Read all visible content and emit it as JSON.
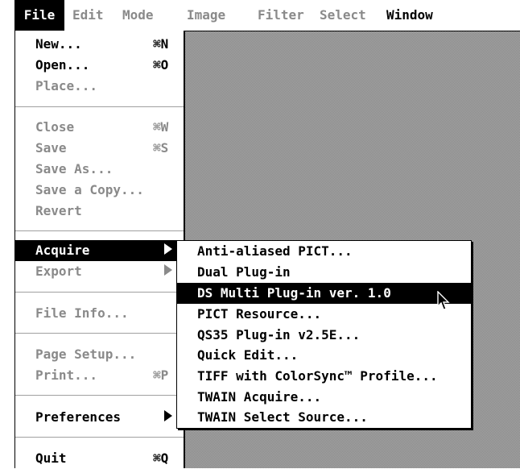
{
  "menubar": {
    "items": [
      {
        "label": "File",
        "state": "active"
      },
      {
        "label": "Edit",
        "state": "disabled"
      },
      {
        "label": "Mode",
        "state": "disabled"
      },
      {
        "label": "Image",
        "state": "disabled"
      },
      {
        "label": "Filter",
        "state": "disabled"
      },
      {
        "label": "Select",
        "state": "disabled"
      },
      {
        "label": "Window",
        "state": "enabled"
      }
    ]
  },
  "file_menu": {
    "items": [
      {
        "label": "New...",
        "shortcut": "⌘N",
        "enabled": true
      },
      {
        "label": "Open...",
        "shortcut": "⌘O",
        "enabled": true
      },
      {
        "label": "Place...",
        "shortcut": "",
        "enabled": false
      },
      {
        "label": "Close",
        "shortcut": "⌘W",
        "enabled": false
      },
      {
        "label": "Save",
        "shortcut": "⌘S",
        "enabled": false
      },
      {
        "label": "Save As...",
        "shortcut": "",
        "enabled": false
      },
      {
        "label": "Save a Copy...",
        "shortcut": "",
        "enabled": false
      },
      {
        "label": "Revert",
        "shortcut": "",
        "enabled": false
      },
      {
        "label": "Acquire",
        "shortcut": "",
        "enabled": true,
        "submenu": true,
        "highlighted": true
      },
      {
        "label": "Export",
        "shortcut": "",
        "enabled": false,
        "submenu": true
      },
      {
        "label": "File Info...",
        "shortcut": "",
        "enabled": false
      },
      {
        "label": "Page Setup...",
        "shortcut": "",
        "enabled": false
      },
      {
        "label": "Print...",
        "shortcut": "⌘P",
        "enabled": false
      },
      {
        "label": "Preferences",
        "shortcut": "",
        "enabled": true,
        "submenu": true
      },
      {
        "label": "Quit",
        "shortcut": "⌘Q",
        "enabled": true
      }
    ]
  },
  "acquire_submenu": {
    "items": [
      {
        "label": "Anti-aliased PICT..."
      },
      {
        "label": "Dual Plug-in"
      },
      {
        "label": "DS Multi Plug-in ver. 1.0",
        "highlighted": true
      },
      {
        "label": "PICT Resource..."
      },
      {
        "label": "QS35 Plug-in v2.5E..."
      },
      {
        "label": "Quick Edit..."
      },
      {
        "label": "TIFF with ColorSync™ Profile..."
      },
      {
        "label": "TWAIN Acquire..."
      },
      {
        "label": "TWAIN Select Source..."
      }
    ]
  },
  "icons": {
    "submenu_arrow": "right-triangle-icon",
    "cursor": "arrow-pointer-icon"
  },
  "colors": {
    "disabled_text": "#8a8a8a",
    "highlight_bg": "#000000",
    "highlight_text": "#ffffff",
    "desktop": "#a6a6a6"
  }
}
